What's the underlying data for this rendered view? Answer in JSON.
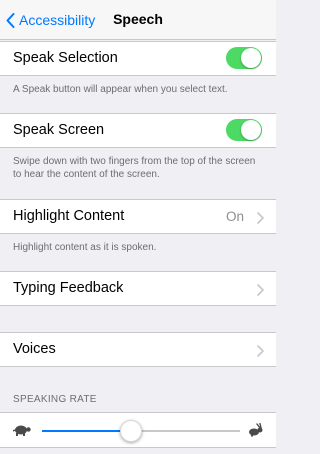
{
  "navbar": {
    "back_label": "Accessibility",
    "title": "Speech"
  },
  "speak_selection": {
    "label": "Speak Selection",
    "enabled": true,
    "footer": "A Speak button will appear when you select text."
  },
  "speak_screen": {
    "label": "Speak Screen",
    "enabled": true,
    "footer": "Swipe down with two fingers from the top of the screen to hear the content of the screen."
  },
  "highlight_content": {
    "label": "Highlight Content",
    "value": "On",
    "footer": "Highlight content as it is spoken."
  },
  "typing_feedback": {
    "label": "Typing Feedback"
  },
  "voices": {
    "label": "Voices"
  },
  "speaking_rate": {
    "header": "SPEAKING RATE",
    "value_fraction": 0.45
  },
  "icons": {
    "back": "chevron-left-icon",
    "disclosure": "chevron-right-icon",
    "slow": "turtle-icon",
    "fast": "hare-icon"
  },
  "colors": {
    "accent": "#007aff",
    "toggle_on": "#4cd964",
    "background": "#efeff4"
  }
}
